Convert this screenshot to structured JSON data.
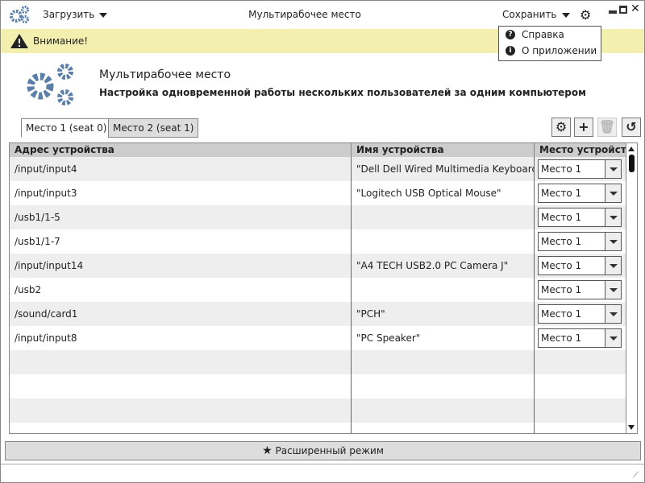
{
  "titlebar": {
    "load_label": "Загрузить",
    "title": "Мультирабочее место",
    "save_label": "Сохранить"
  },
  "menu": {
    "items": [
      {
        "label": "Справка",
        "icon": "question-icon"
      },
      {
        "label": "О приложении",
        "icon": "info-icon"
      }
    ]
  },
  "warning": {
    "text": "Внимание!"
  },
  "header": {
    "title": "Мультирабочее место",
    "subtitle": "Настройка одновременной работы нескольких пользователей за одним компьютером"
  },
  "tabs": [
    {
      "label": "Место 1 (seat 0)",
      "active": true
    },
    {
      "label": "Место 2 (seat 1)",
      "active": false
    }
  ],
  "table": {
    "columns": [
      "Адрес устройства",
      "Имя устройства",
      "Место устройства"
    ],
    "rows": [
      {
        "address": "/input/input4",
        "name": "\"Dell Dell Wired Multimedia Keyboard\"",
        "seat": "Место 1"
      },
      {
        "address": "/input/input3",
        "name": "\"Logitech USB Optical Mouse\"",
        "seat": "Место 1"
      },
      {
        "address": "/usb1/1-5",
        "name": "",
        "seat": "Место 1"
      },
      {
        "address": "/usb1/1-7",
        "name": "",
        "seat": "Место 1"
      },
      {
        "address": "/input/input14",
        "name": "\"A4 TECH USB2.0 PC Camera J\"",
        "seat": "Место 1"
      },
      {
        "address": "/usb2",
        "name": "",
        "seat": "Место 1"
      },
      {
        "address": "/sound/card1",
        "name": "\"PCH\"",
        "seat": "Место 1"
      },
      {
        "address": "/input/input8",
        "name": "\"PC Speaker\"",
        "seat": "Место 1"
      }
    ]
  },
  "footer": {
    "advanced_label": "Расширенный режим"
  },
  "colors": {
    "accent": "#5a7fab",
    "warning_bg": "#f3efae"
  }
}
